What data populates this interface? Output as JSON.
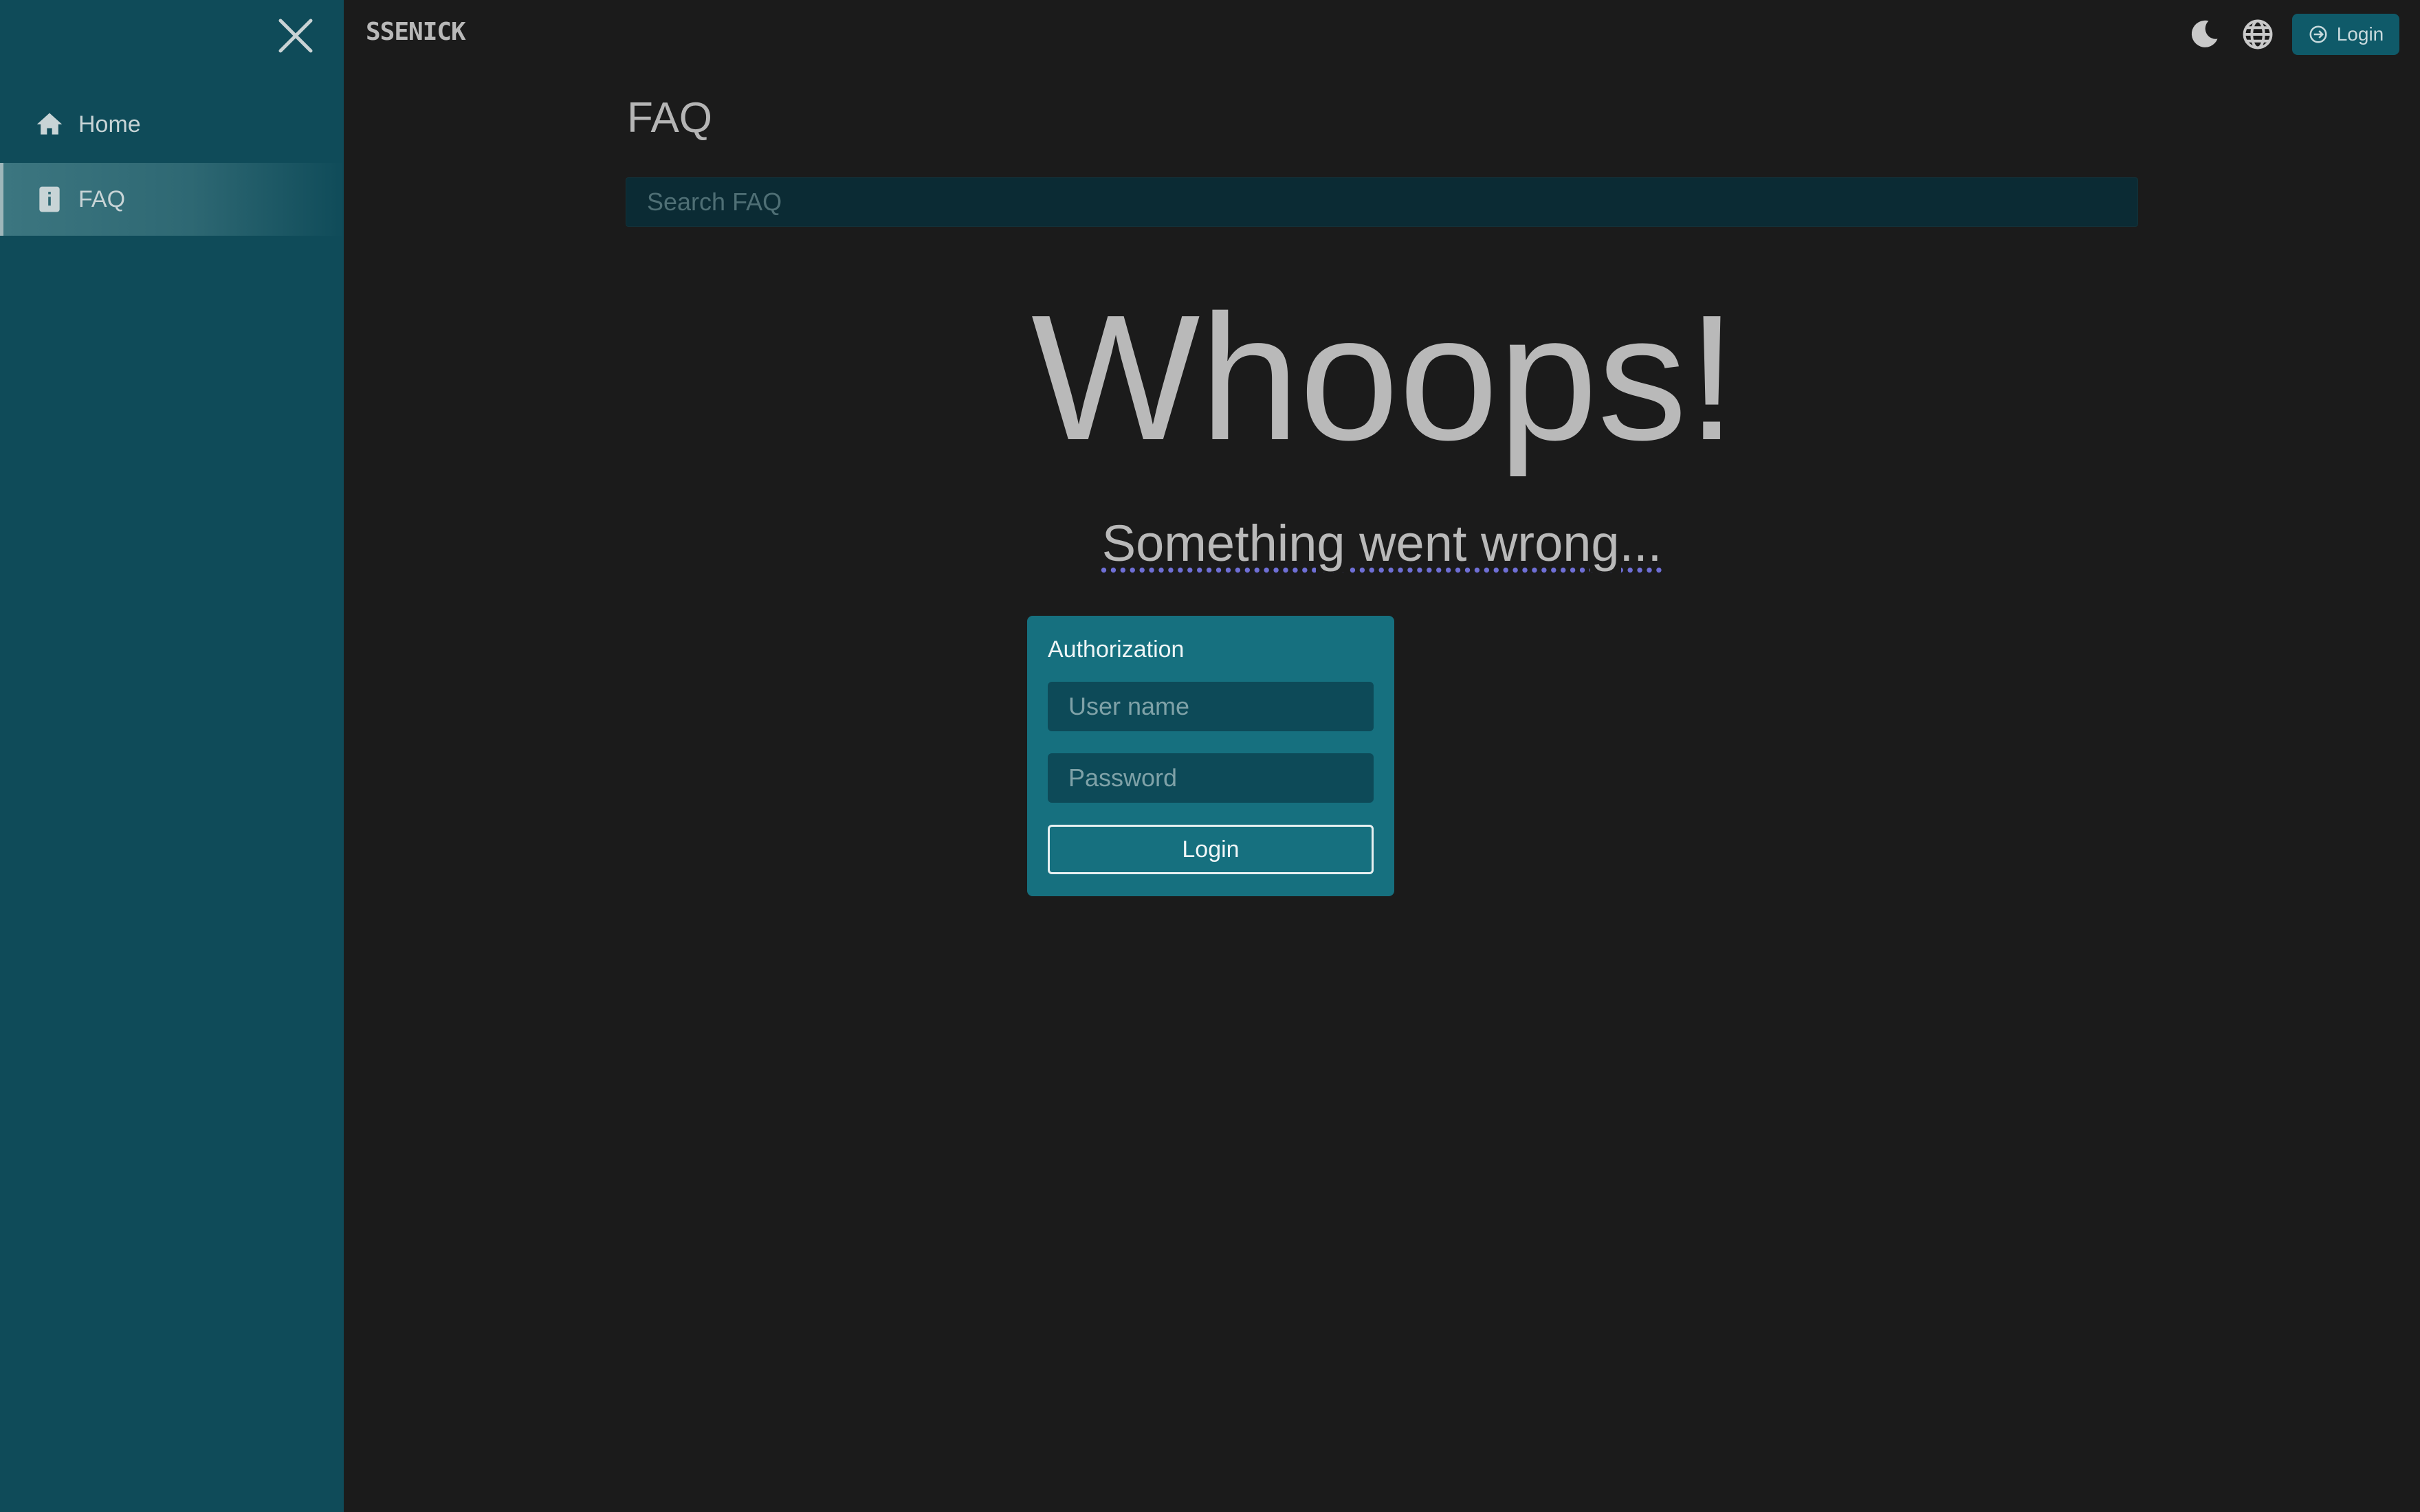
{
  "app": {
    "brand": "SSENICK"
  },
  "sidebar": {
    "items": [
      {
        "label": "Home",
        "icon": "home-icon"
      },
      {
        "label": "FAQ",
        "icon": "info-book-icon",
        "active": true
      }
    ]
  },
  "header": {
    "login_label": "Login",
    "icons": [
      "moon-icon",
      "globe-icon",
      "login-icon"
    ]
  },
  "main": {
    "title": "FAQ",
    "search_placeholder": "Search FAQ"
  },
  "error": {
    "heading": "Whoops!",
    "message": "Something went wrong..."
  },
  "auth": {
    "title": "Authorization",
    "username_placeholder": "User name",
    "password_placeholder": "Password",
    "login_label": "Login"
  },
  "colors": {
    "sidebar_bg": "#0f4b59",
    "page_bg": "#1b1b1b",
    "card_bg": "#16707f",
    "accent": "#0f5a69"
  }
}
